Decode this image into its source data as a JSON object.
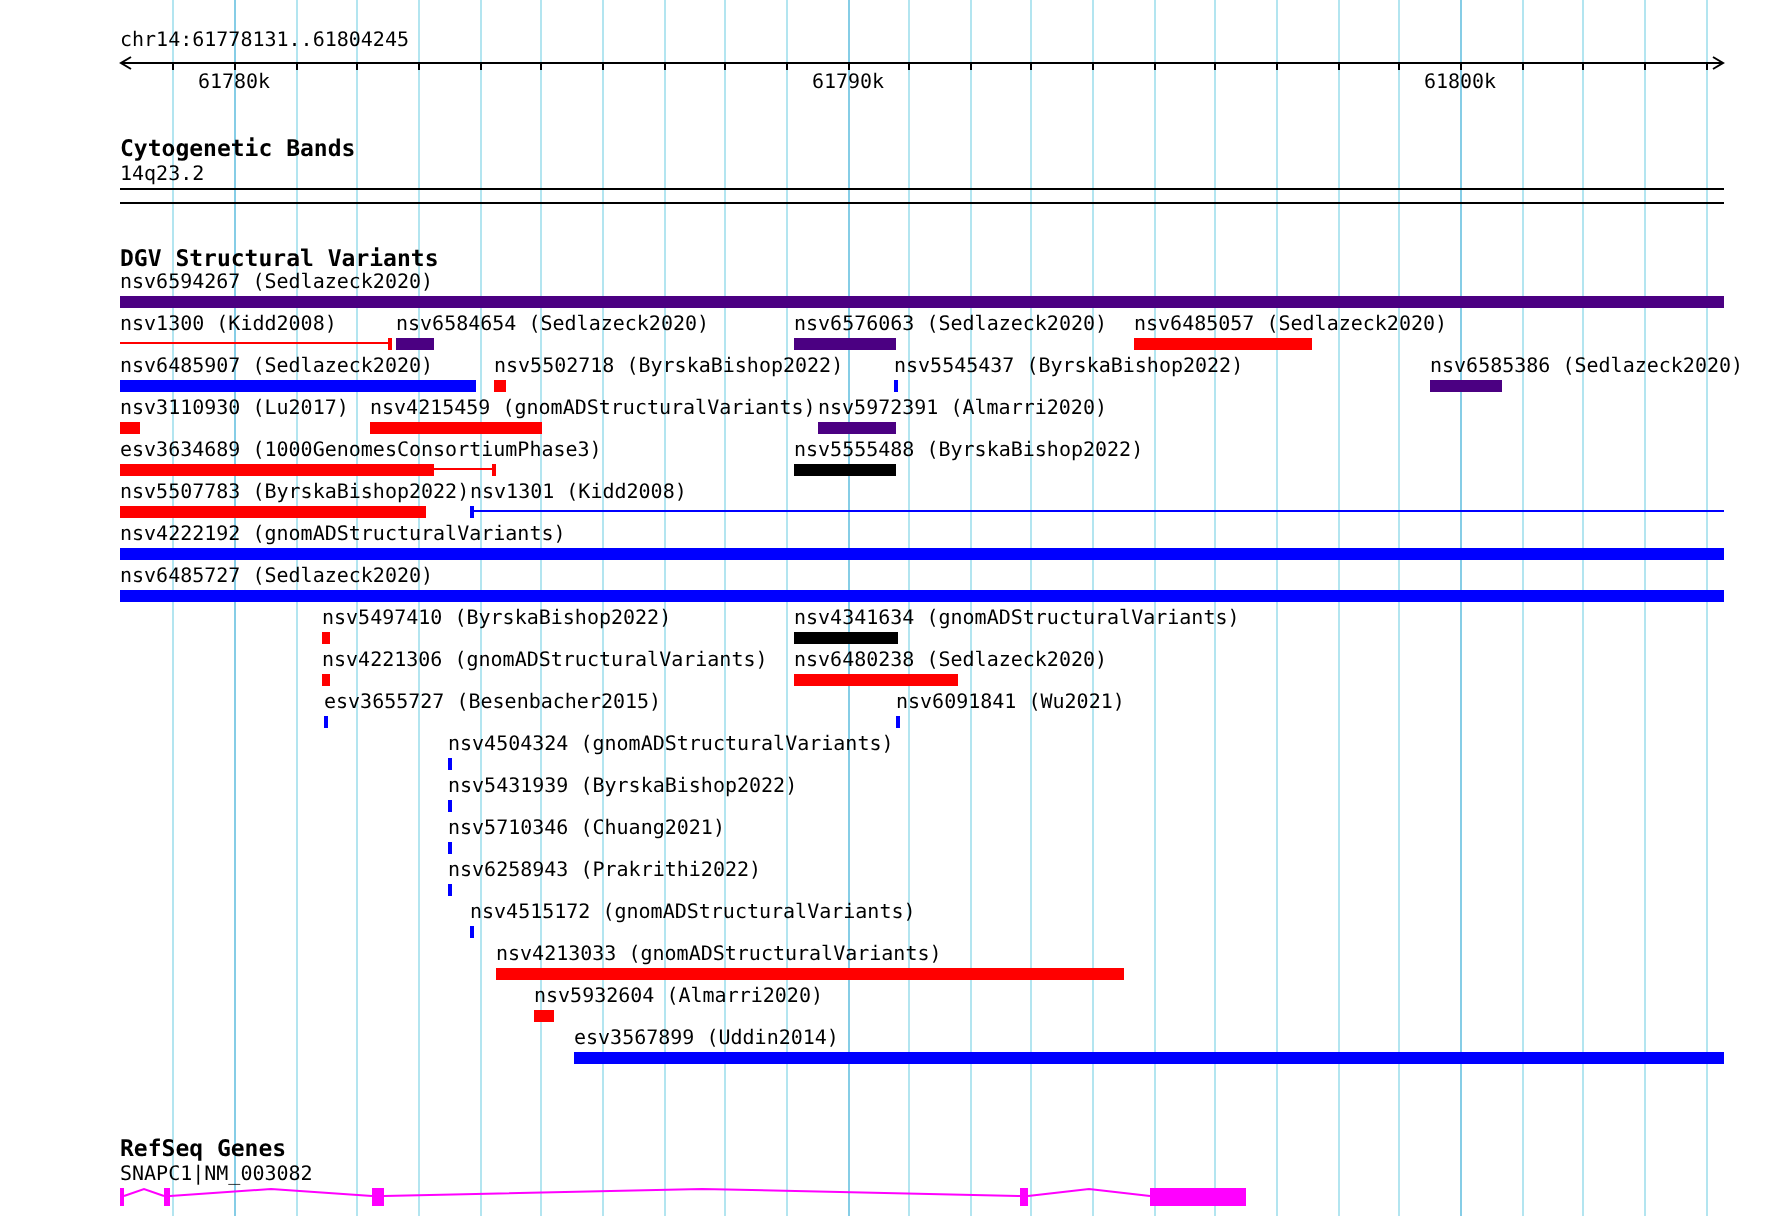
{
  "ruler": {
    "location": "chr14:61778131..61804245",
    "ticks": [
      "61780k",
      "61790k",
      "61800k"
    ]
  },
  "tracks": [
    {
      "kind": "bands",
      "title": "Cytogenetic Bands",
      "features": [
        {
          "label": "14q23.2"
        }
      ]
    },
    {
      "kind": "variants",
      "title": "DGV Structural Variants",
      "features": [
        {
          "label": "nsv6594267 (Sedlazeck2020)",
          "kind": "bar",
          "color": "#4b0082"
        },
        {
          "label": "nsv1300 (Kidd2008)",
          "kind": "line",
          "color": "#ff0000"
        },
        {
          "label": "nsv6584654 (Sedlazeck2020)",
          "kind": "bar",
          "color": "#4b0082"
        },
        {
          "label": "nsv6576063 (Sedlazeck2020)",
          "kind": "bar",
          "color": "#4b0082"
        },
        {
          "label": "nsv6485057 (Sedlazeck2020)",
          "kind": "bar",
          "color": "#ff0000"
        },
        {
          "label": "nsv6485907 (Sedlazeck2020)",
          "kind": "bar",
          "color": "#0000ff"
        },
        {
          "label": "nsv5502718 (ByrskaBishop2022)",
          "kind": "bar",
          "color": "#ff0000"
        },
        {
          "label": "nsv5545437 (ByrskaBishop2022)",
          "kind": "bar",
          "color": "#0000ff"
        },
        {
          "label": "nsv6585386 (Sedlazeck2020)",
          "kind": "bar",
          "color": "#4b0082"
        },
        {
          "label": "nsv3110930 (Lu2017)",
          "kind": "bar",
          "color": "#ff0000"
        },
        {
          "label": "nsv4215459 (gnomADStructuralVariants)",
          "kind": "bar",
          "color": "#ff0000"
        },
        {
          "label": "nsv5972391 (Almarri2020)",
          "kind": "bar",
          "color": "#4b0082"
        },
        {
          "label": "esv3634689 (1000GenomesConsortiumPhase3)",
          "kind": "bar-line",
          "color": "#ff0000"
        },
        {
          "label": "nsv5555488 (ByrskaBishop2022)",
          "kind": "bar",
          "color": "#000000"
        },
        {
          "label": "nsv5507783 (ByrskaBishop2022)",
          "kind": "bar",
          "color": "#ff0000"
        },
        {
          "label": "nsv1301 (Kidd2008)",
          "kind": "line",
          "color": "#0000ff"
        },
        {
          "label": "nsv4222192 (gnomADStructuralVariants)",
          "kind": "bar",
          "color": "#0000ff"
        },
        {
          "label": "nsv6485727 (Sedlazeck2020)",
          "kind": "bar",
          "color": "#0000ff"
        },
        {
          "label": "nsv5497410 (ByrskaBishop2022)",
          "kind": "bar",
          "color": "#ff0000"
        },
        {
          "label": "nsv4341634 (gnomADStructuralVariants)",
          "kind": "bar",
          "color": "#000000"
        },
        {
          "label": "nsv4221306 (gnomADStructuralVariants)",
          "kind": "bar",
          "color": "#ff0000"
        },
        {
          "label": "nsv6480238 (Sedlazeck2020)",
          "kind": "bar",
          "color": "#ff0000"
        },
        {
          "label": "esv3655727 (Besenbacher2015)",
          "kind": "bar",
          "color": "#0000ff"
        },
        {
          "label": "nsv6091841 (Wu2021)",
          "kind": "bar",
          "color": "#0000ff"
        },
        {
          "label": "nsv4504324 (gnomADStructuralVariants)",
          "kind": "bar",
          "color": "#0000ff"
        },
        {
          "label": "nsv5431939 (ByrskaBishop2022)",
          "kind": "bar",
          "color": "#0000ff"
        },
        {
          "label": "nsv5710346 (Chuang2021)",
          "kind": "bar",
          "color": "#0000ff"
        },
        {
          "label": "nsv6258943 (Prakrithi2022)",
          "kind": "bar",
          "color": "#0000ff"
        },
        {
          "label": "nsv4515172 (gnomADStructuralVariants)",
          "kind": "bar",
          "color": "#0000ff"
        },
        {
          "label": "nsv4213033 (gnomADStructuralVariants)",
          "kind": "bar",
          "color": "#ff0000"
        },
        {
          "label": "nsv5932604 (Almarri2020)",
          "kind": "bar",
          "color": "#ff0000"
        },
        {
          "label": "esv3567899 (Uddin2014)",
          "kind": "bar",
          "color": "#0000ff"
        }
      ]
    },
    {
      "kind": "genes",
      "title": "RefSeq Genes",
      "features": [
        {
          "label": "SNAPC1|NM_003082"
        }
      ]
    }
  ]
}
